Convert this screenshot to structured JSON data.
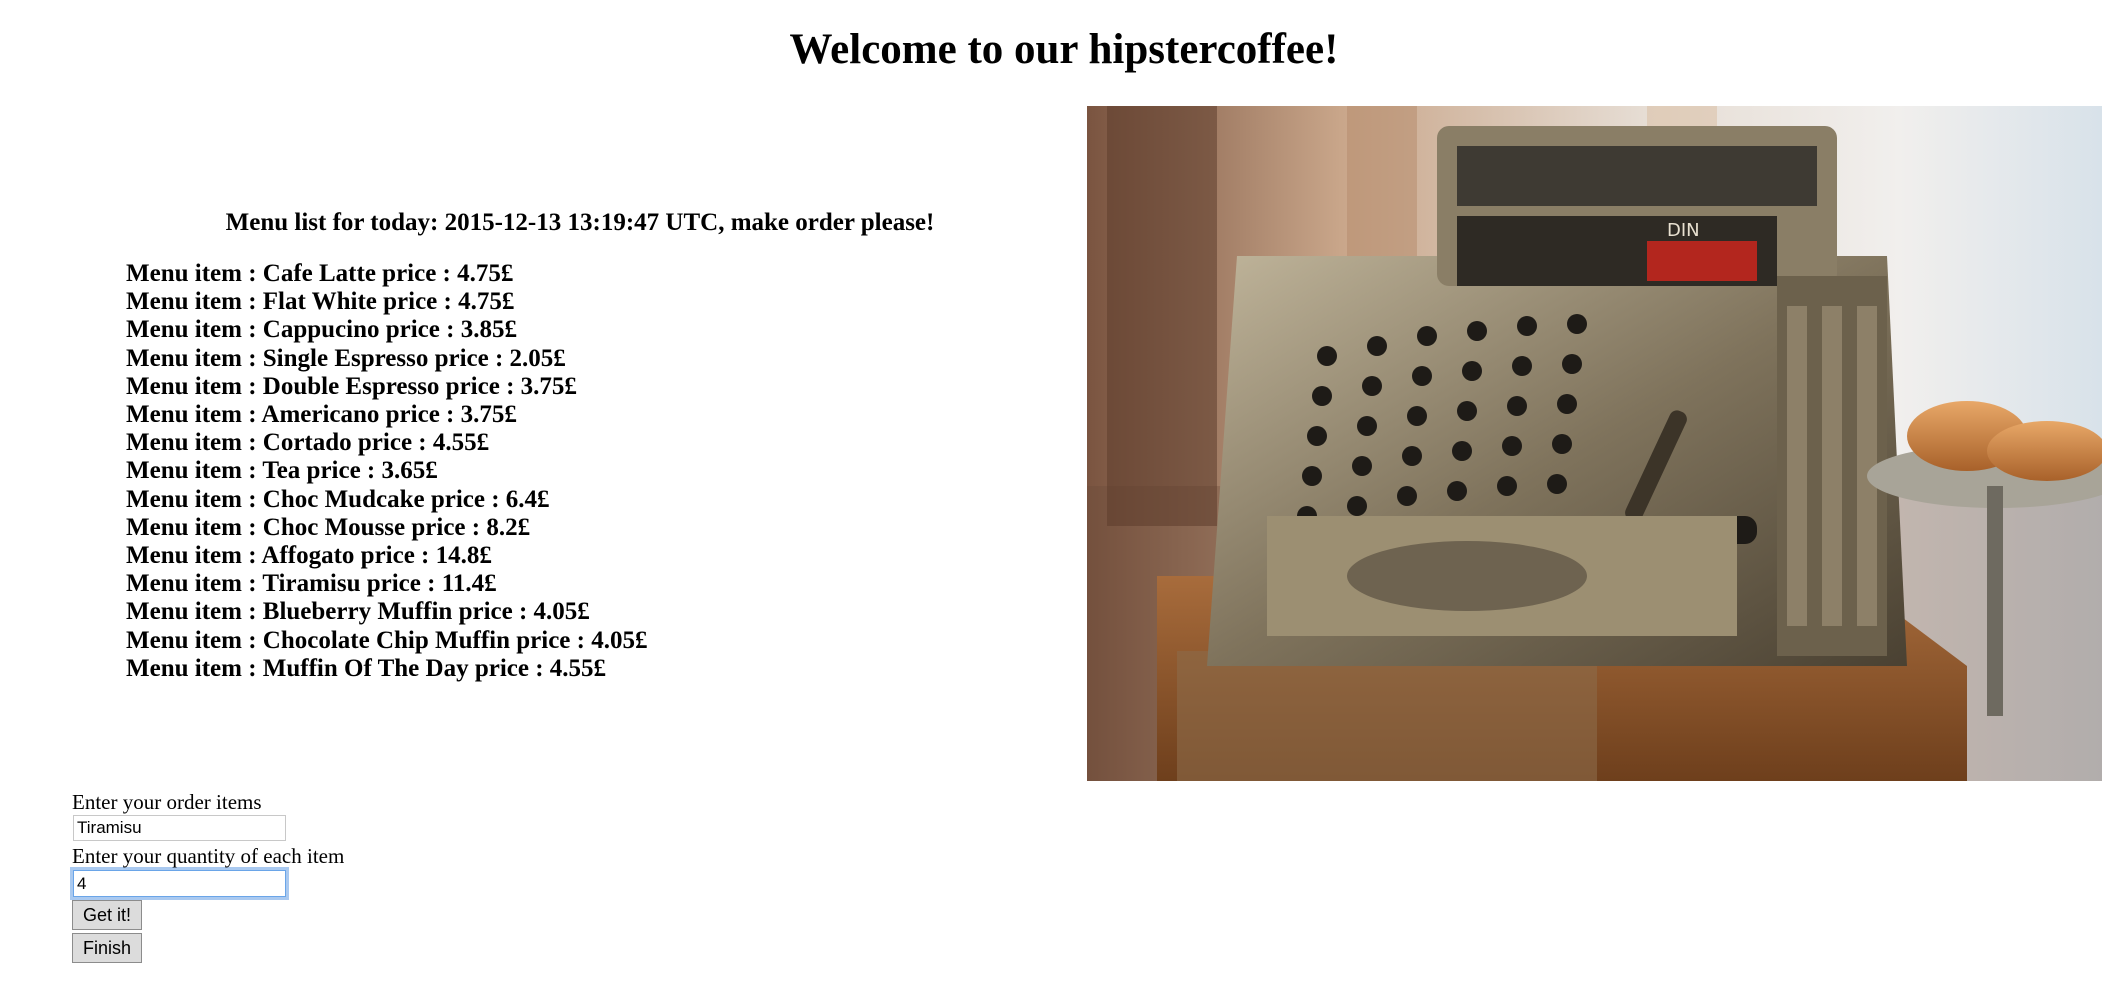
{
  "header": {
    "title": "Welcome to our hipstercoffee!"
  },
  "menu": {
    "heading": "Menu list for today: 2015-12-13 13:19:47 UTC, make order please!",
    "items": [
      "Menu item : Cafe Latte price : 4.75£",
      "Menu item : Flat White price : 4.75£",
      "Menu item : Cappucino price : 3.85£",
      "Menu item : Single Espresso price : 2.05£",
      "Menu item : Double Espresso price : 3.75£",
      "Menu item : Americano price : 3.75£",
      "Menu item : Cortado price : 4.55£",
      "Menu item : Tea price : 3.65£",
      "Menu item : Choc Mudcake price : 6.4£",
      "Menu item : Choc Mousse price : 8.2£",
      "Menu item : Affogato price : 14.8£",
      "Menu item : Tiramisu price : 11.4£",
      "Menu item : Blueberry Muffin price : 4.05£",
      "Menu item : Chocolate Chip Muffin price : 4.05£",
      "Menu item : Muffin Of The Day price : 4.55£"
    ]
  },
  "photo": {
    "label": "DIN"
  },
  "order_form": {
    "items_label": "Enter your order items",
    "items_value": "Tiramisu",
    "quantity_label": "Enter your quantity of each item",
    "quantity_value": "4",
    "get_button": "Get it!",
    "finish_button": "Finish"
  }
}
